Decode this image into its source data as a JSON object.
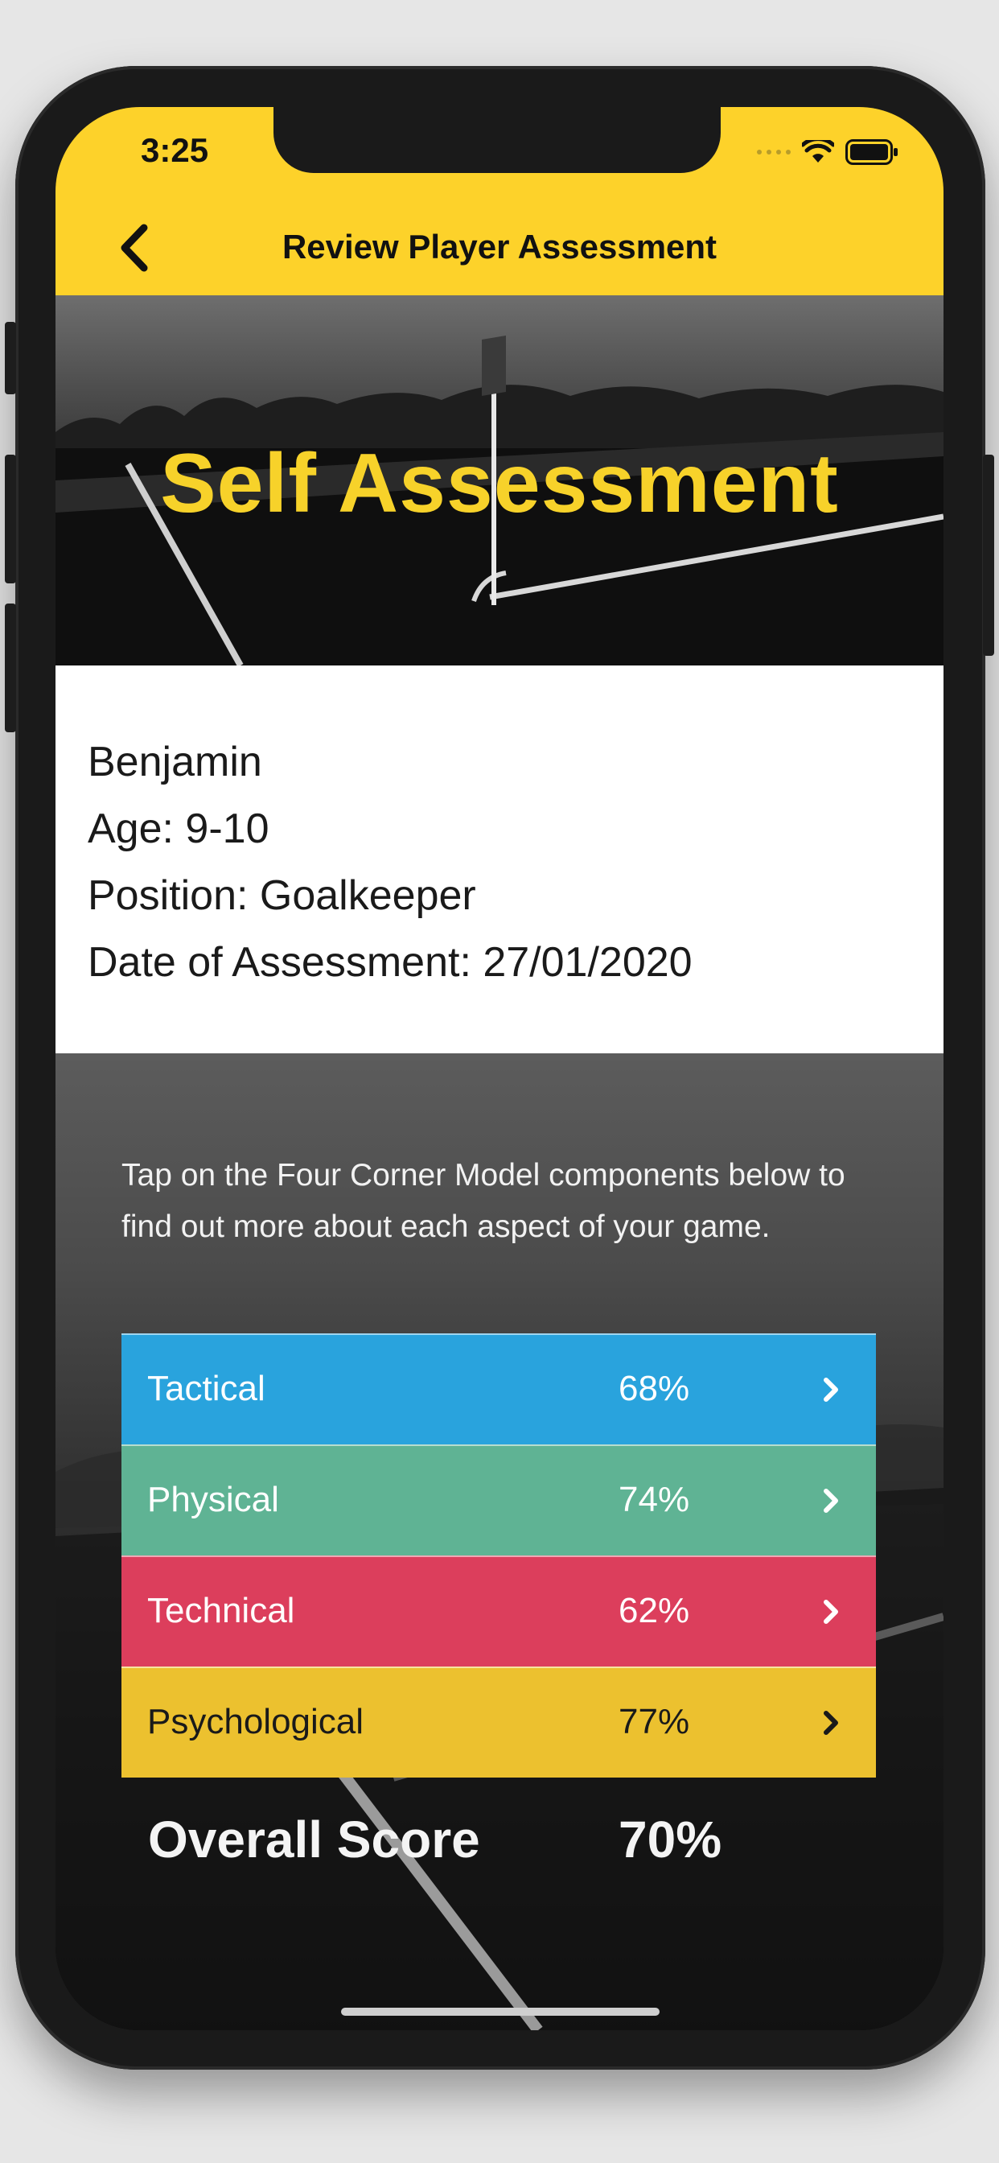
{
  "status_bar": {
    "time": "3:25"
  },
  "nav": {
    "title": "Review Player Assessment",
    "back_icon": "chevron-left-icon"
  },
  "hero": {
    "title": "Self Assessment"
  },
  "player": {
    "name": "Benjamin",
    "age": "Age: 9-10",
    "position": "Position: Goalkeeper",
    "date": "Date of Assessment: 27/01/2020"
  },
  "panel": {
    "intro": "Tap on the Four Corner Model components below to find out more about each aspect of your game.",
    "components": [
      {
        "label": "Tactical",
        "percent": "68%",
        "color": "#29a3dd",
        "text_color": "#ffffff"
      },
      {
        "label": "Physical",
        "percent": "74%",
        "color": "#5fb394",
        "text_color": "#ffffff"
      },
      {
        "label": "Technical",
        "percent": "62%",
        "color": "#dc3e5c",
        "text_color": "#ffffff"
      },
      {
        "label": "Psychological",
        "percent": "77%",
        "color": "#ecc12f",
        "text_color": "#1a1a1a"
      }
    ],
    "overall_label": "Overall Score",
    "overall_value": "70%"
  },
  "colors": {
    "accent": "#fdd22a",
    "hero_title": "#f7d22a"
  }
}
